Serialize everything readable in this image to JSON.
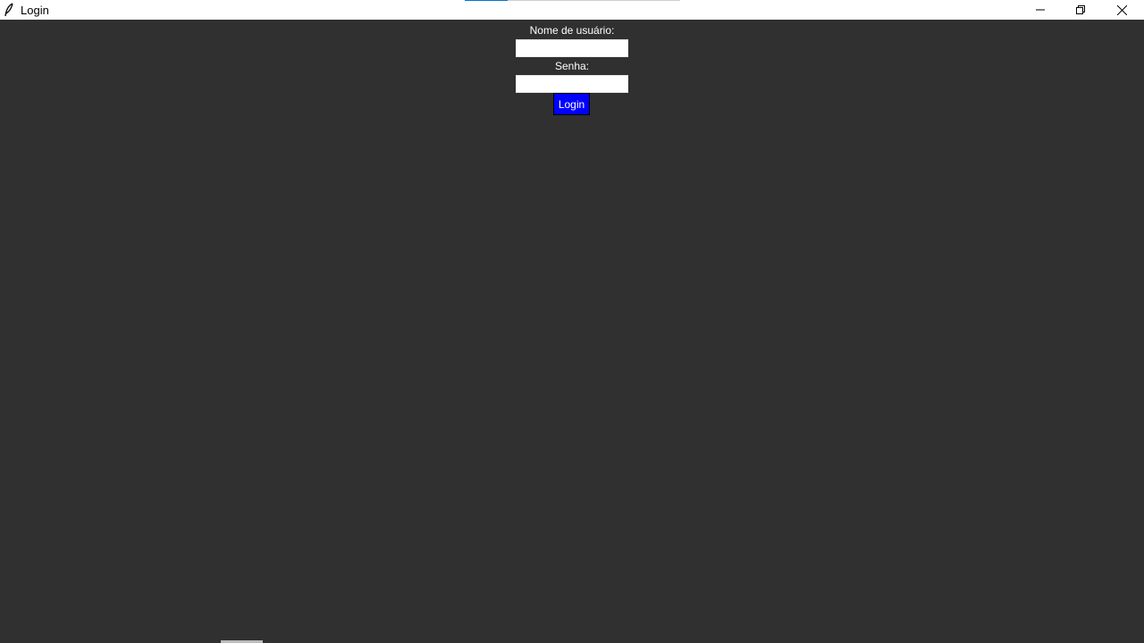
{
  "window": {
    "title": "Login",
    "icon": "feather-icon",
    "controls": {
      "minimize": "minimize-icon",
      "maximize": "restore-icon",
      "close": "close-icon"
    }
  },
  "form": {
    "username_label": "Nome de usuário:",
    "username_value": "",
    "password_label": "Senha:",
    "password_value": "",
    "login_label": "Login"
  },
  "colors": {
    "background": "#303030",
    "button": "#0000ff",
    "accent": "#0078d7"
  }
}
